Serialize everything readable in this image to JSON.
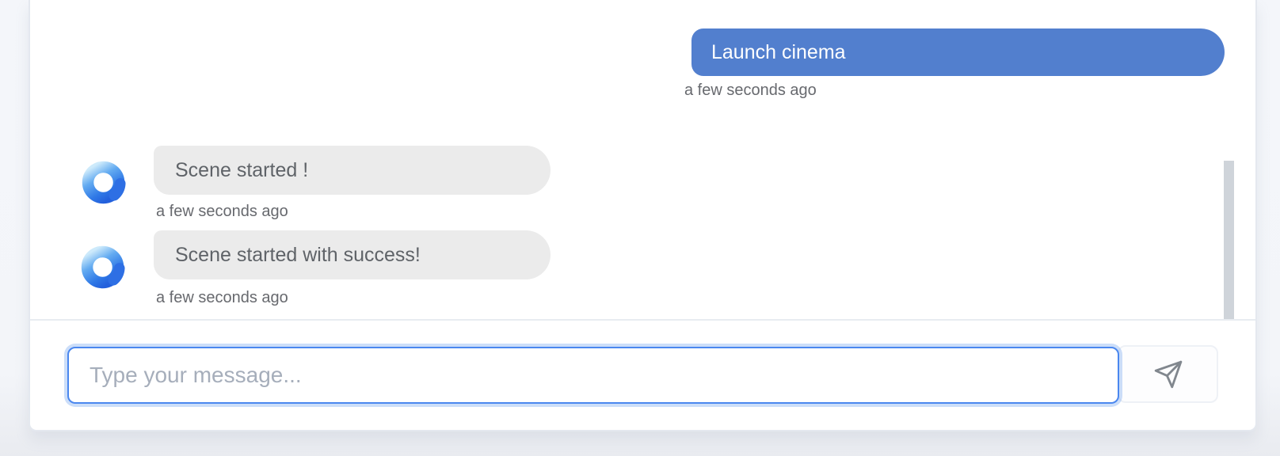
{
  "theme": {
    "accent_blue": "#527fce",
    "input_border_blue": "#4a87ef",
    "bubble_gray": "#ebebeb",
    "page_background": "#f4f6fa",
    "panel_border": "#e4e8ef",
    "bot_text": "#5f6368",
    "timestamp_gray": "#67696e",
    "placeholder_gray": "#a6aebb",
    "scrollbar_thumb": "#cfd4da",
    "send_icon_gray": "#81878e"
  },
  "chat": {
    "messages": [
      {
        "sender": "user",
        "text": "Launch cinema",
        "timestamp": "a few seconds ago"
      },
      {
        "sender": "bot",
        "text": "Scene started !",
        "timestamp": "a few seconds ago"
      },
      {
        "sender": "bot",
        "text": "Scene started with success!",
        "timestamp": "a few seconds ago"
      }
    ],
    "avatar": {
      "icon": "bot-logo-blue-swirl-ring"
    },
    "input": {
      "value": "",
      "placeholder": "Type your message...",
      "focused": true
    },
    "send_button": {
      "icon": "paper-plane-send-icon"
    },
    "scrollbar": {
      "visible": true
    }
  }
}
